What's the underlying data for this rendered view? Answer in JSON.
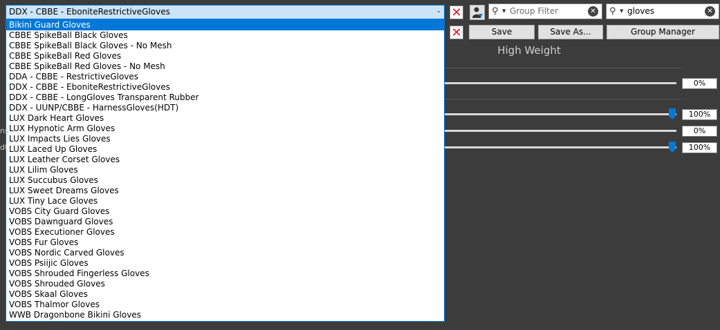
{
  "preset": {
    "selected": "DDX - CBBE - EboniteRestrictiveGloves",
    "items": [
      "Bikini Guard Gloves",
      "CBBE SpikeBall Black Gloves",
      "CBBE SpikeBall Black Gloves - No Mesh",
      "CBBE SpikeBall Red Gloves",
      "CBBE SpikeBall Red Gloves - No Mesh",
      "DDA - CBBE - RestrictiveGloves",
      "DDX - CBBE - EboniteRestrictiveGloves",
      "DDX - CBBE - LongGloves Transparent Rubber",
      "DDX - UUNP/CBBE - HarnessGloves(HDT)",
      "LUX Dark Heart Gloves",
      "LUX Hypnotic Arm Gloves",
      "LUX Impacts Lies Gloves",
      "LUX Laced Up Gloves",
      "LUX Leather Corset Gloves",
      "LUX Lilim Gloves",
      "LUX Succubus Gloves",
      "LUX Sweet Dreams Gloves",
      "LUX Tiny Lace Gloves",
      "VOBS City Guard Gloves",
      "VOBS Dawnguard Gloves",
      "VOBS Executioner Gloves",
      "VOBS Fur Gloves",
      "VOBS Nordic Carved Gloves",
      "VOBS Psiijic Gloves",
      "VOBS Shrouded Fingerless Gloves",
      "VOBS Shrouded Gloves",
      "VOBS Skaal Gloves",
      "VOBS Thalmor Gloves",
      "WWB Dragonbone Bikini Gloves"
    ],
    "highlighted_index": 0
  },
  "group_filter": {
    "placeholder": "Group Filter",
    "value": ""
  },
  "outfit_filter": {
    "value": "gloves"
  },
  "buttons": {
    "save": "Save",
    "save_as": "Save As...",
    "group_manager": "Group Manager"
  },
  "weights": {
    "high_weight_label": "High Weight",
    "sliders": [
      {
        "value": "0%",
        "level": 0
      },
      {
        "value": "100%",
        "level": 100
      },
      {
        "value": "0%",
        "level": 0
      },
      {
        "value": "100%",
        "level": 100
      }
    ]
  },
  "clipped_labels": [
    "ns",
    "dt"
  ],
  "icons": {
    "delete": "red-x-icon",
    "filter_toggle": "person-filter-icon",
    "search": "magnifier-icon",
    "clear": "clear-circle-icon",
    "dropdown": "chevron-down-icon"
  },
  "colors": {
    "background": "#3c3c3c",
    "selection": "#0078d7",
    "delete": "#e81123",
    "slider_thumb": "#0078d7"
  }
}
